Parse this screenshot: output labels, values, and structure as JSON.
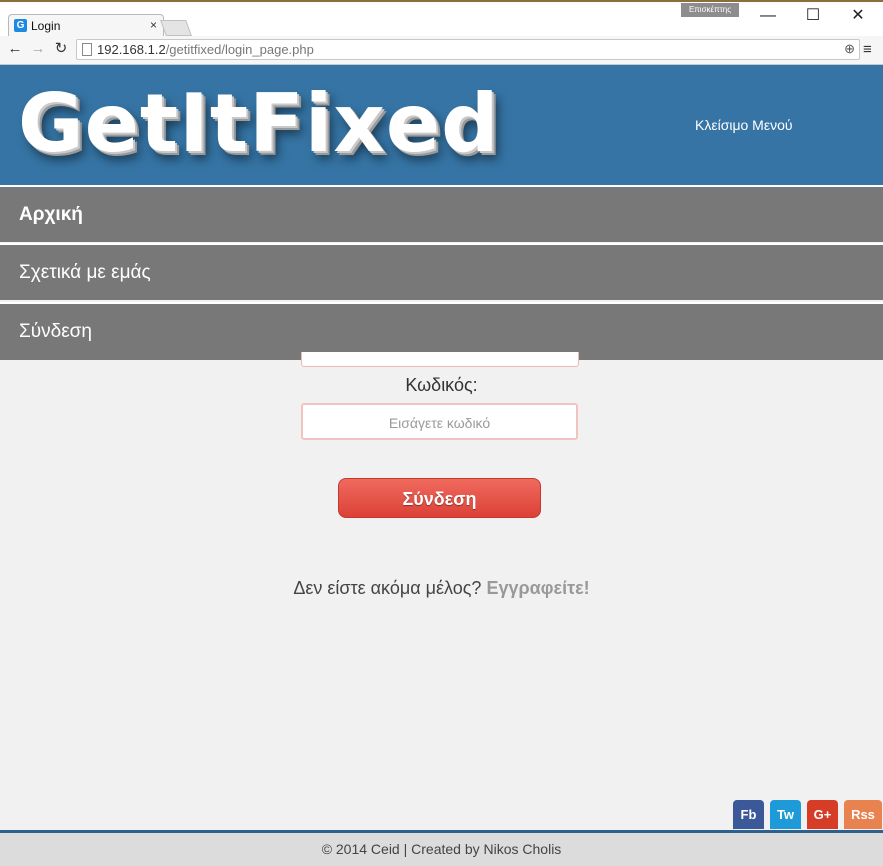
{
  "browser": {
    "tab_title": "Login",
    "tab_close": "×",
    "favicon_letter": "G",
    "profile_label": "Επισκέπτης",
    "window_controls": {
      "minimize": "—",
      "maximize": "☐",
      "close": "✕"
    },
    "nav": {
      "back": "←",
      "forward": "→",
      "reload": "↻"
    },
    "url_host": "192.168.1.2",
    "url_path": "/getitfixed/login_page.php",
    "zoom_icon": "⊕",
    "menu_icon": "≡"
  },
  "header": {
    "logo_text": "GetItFixed",
    "close_menu_label": "Κλείσιμο Μενού"
  },
  "nav_menu": {
    "items": [
      {
        "label": "Αρχική"
      },
      {
        "label": "Σχετικά με εμάς"
      },
      {
        "label": "Σύνδεση"
      }
    ]
  },
  "login_form": {
    "password_label": "Κωδικός:",
    "password_placeholder": "Εισάγετε κωδικό",
    "submit_label": "Σύνδεση"
  },
  "signup": {
    "prompt": "Δεν είστε ακόμα μέλος? ",
    "link_text": "Εγγραφείτε!"
  },
  "social": {
    "facebook": {
      "label": "Fb",
      "color": "#3b5998"
    },
    "twitter": {
      "label": "Tw",
      "color": "#1e9ad8"
    },
    "googleplus": {
      "label": "G+",
      "color": "#d53d26"
    },
    "rss": {
      "label": "Rss",
      "color": "#e8824f"
    }
  },
  "footer": {
    "text": "© 2014 Ceid | Created by Nikos Cholis"
  },
  "colors": {
    "header_bg": "#3574a4",
    "nav_bg": "#787878",
    "button_red": "#e4493e",
    "page_bg": "#f2f1f2"
  }
}
